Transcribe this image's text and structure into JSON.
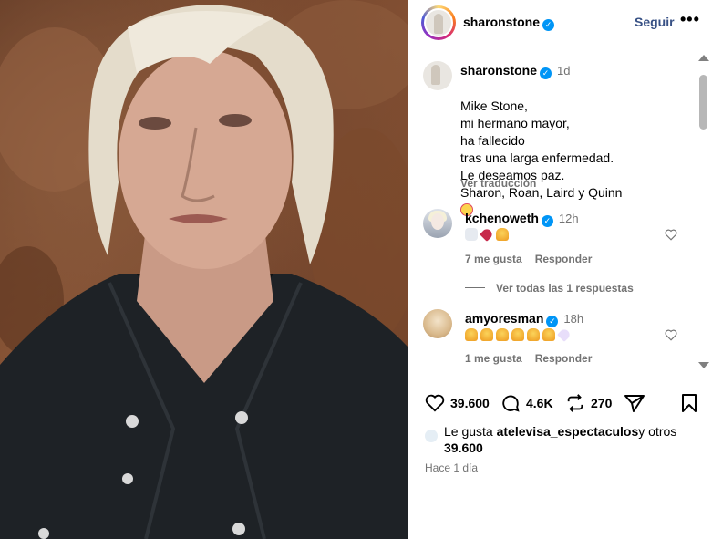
{
  "post": {
    "username": "sharonstone",
    "follow_label": "Seguir",
    "more_label": "•••"
  },
  "caption": {
    "username": "sharonstone",
    "time": "1d",
    "text": "Mike Stone,\nmi hermano mayor,\nha fallecido\ntras una larga enfermedad.\nLe deseamos paz.\nSharon, Roan, Laird y Quinn",
    "emoji_icon": "smiling-face-with-hearts-icon",
    "see_translation": "Ver traducción"
  },
  "comments": [
    {
      "username": "kchenoweth",
      "time": "12h",
      "emoji_icons": [
        "doves-icon",
        "broken-heart-icon",
        "praying-hands-icon"
      ],
      "likes": "7 me gusta",
      "reply_label": "Responder",
      "view_replies": "Ver todas las 1 respuestas"
    },
    {
      "username": "amyoresman",
      "time": "18h",
      "emoji_icons": [
        "praying-hands-icon",
        "praying-hands-icon",
        "praying-hands-icon",
        "praying-hands-icon",
        "praying-hands-icon",
        "praying-hands-icon",
        "white-heart-icon"
      ],
      "likes": "1 me gusta",
      "reply_label": "Responder"
    }
  ],
  "actions": {
    "likes": "39.600",
    "comments": "4.6K",
    "reposts": "270"
  },
  "likes_summary": {
    "prefix": "Le gusta ",
    "account": "atelevisa_espectaculos",
    "suffix": "y otros",
    "count": "39.600"
  },
  "time_ago": "Hace 1 día",
  "colors": {
    "accent": "#0095f6",
    "follow": "#385185",
    "muted": "#737373"
  }
}
